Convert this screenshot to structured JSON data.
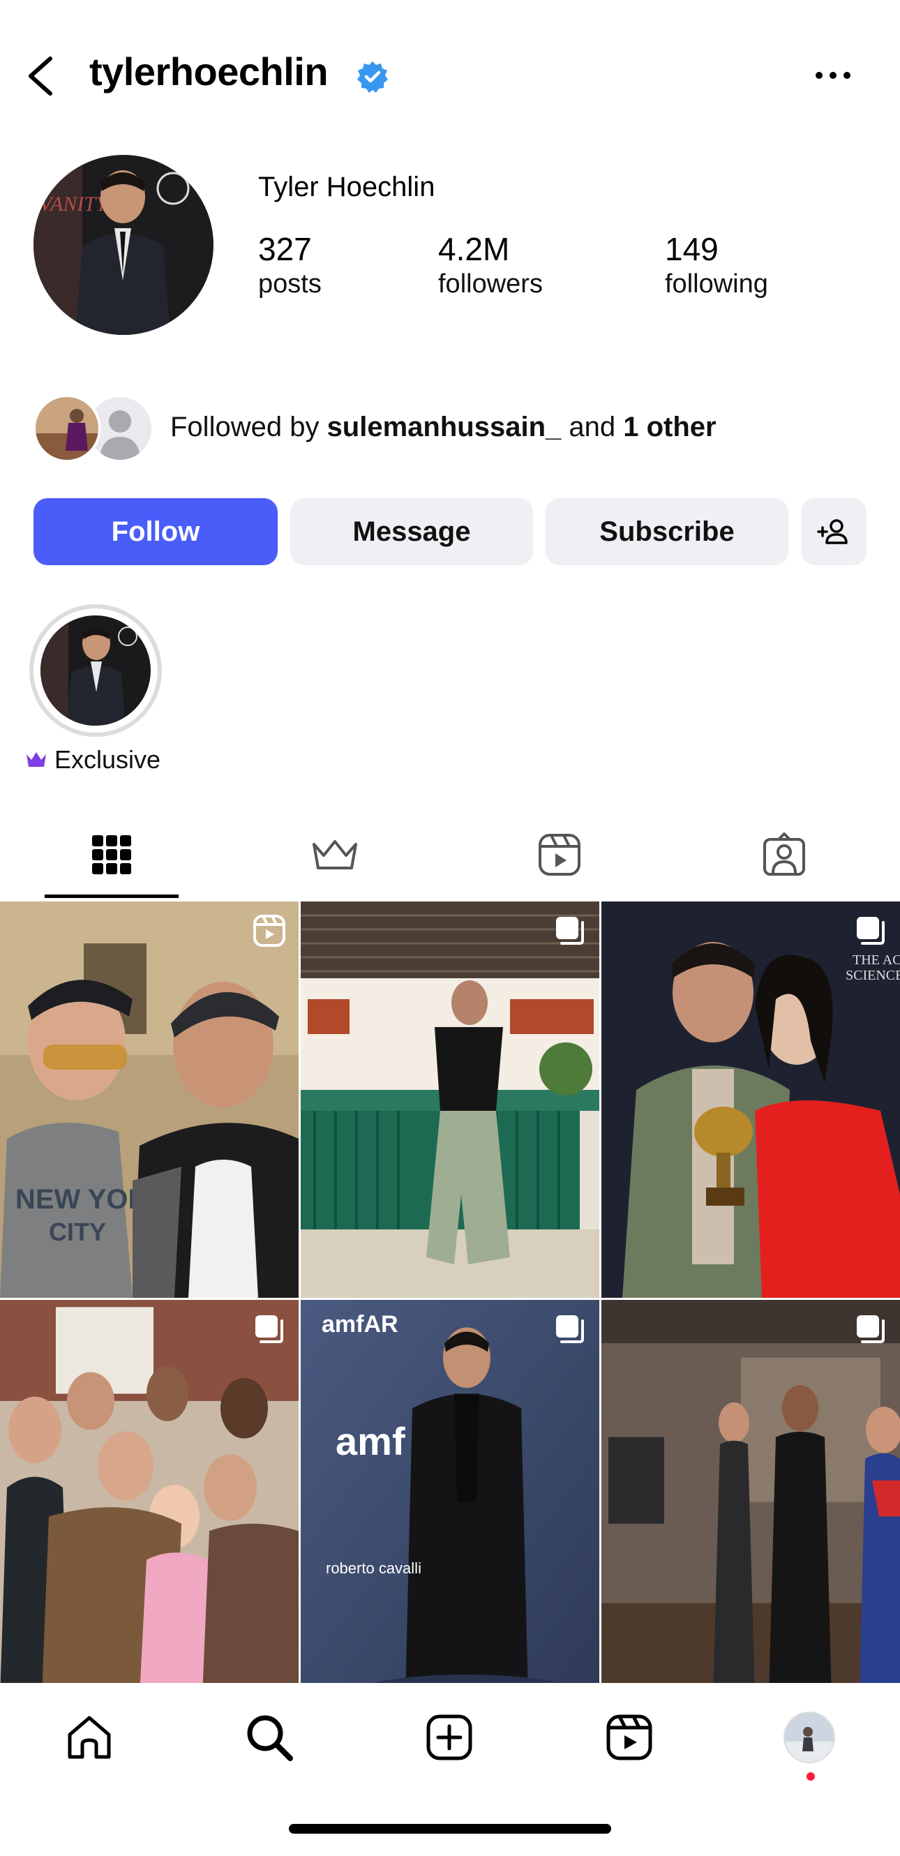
{
  "header": {
    "username": "tylerhoechlin",
    "verified": true,
    "back_icon": "chevron-left-icon",
    "more_icon": "ellipsis-icon"
  },
  "profile": {
    "display_name": "Tyler Hoechlin",
    "stats": [
      {
        "value": "327",
        "label": "posts"
      },
      {
        "value": "4.2M",
        "label": "followers"
      },
      {
        "value": "149",
        "label": "following"
      }
    ],
    "followed_by": {
      "prefix": "Followed by ",
      "name": "sulemanhussain_",
      "middle": " and ",
      "other": "1 other"
    }
  },
  "actions": {
    "follow": "Follow",
    "message": "Message",
    "subscribe": "Subscribe",
    "suggest_icon": "add-person-icon"
  },
  "highlight": {
    "label": "Exclusive",
    "icon": "crown-icon"
  },
  "tabs": [
    {
      "name": "posts-grid",
      "icon": "grid-icon",
      "active": true
    },
    {
      "name": "exclusive",
      "icon": "crown-icon",
      "active": false
    },
    {
      "name": "reels",
      "icon": "reels-icon",
      "active": false
    },
    {
      "name": "tagged",
      "icon": "tagged-person-icon",
      "active": false
    }
  ],
  "grid": [
    {
      "type": "reel",
      "icon": "reels-icon"
    },
    {
      "type": "carousel",
      "icon": "carousel-icon"
    },
    {
      "type": "carousel",
      "icon": "carousel-icon"
    },
    {
      "type": "carousel",
      "icon": "carousel-icon"
    },
    {
      "type": "carousel",
      "icon": "carousel-icon",
      "brand_text": "amfAR",
      "brand_text_2": "amf",
      "brand_text_3": "roberto cavalli"
    },
    {
      "type": "carousel",
      "icon": "carousel-icon"
    }
  ],
  "bottom_nav": [
    {
      "name": "home",
      "icon": "home-icon"
    },
    {
      "name": "search",
      "icon": "search-icon"
    },
    {
      "name": "create",
      "icon": "plus-square-icon"
    },
    {
      "name": "reels",
      "icon": "reels-icon"
    },
    {
      "name": "profile",
      "icon": "profile-avatar",
      "has_notification": true
    }
  ],
  "colors": {
    "follow_button": "#4a5df9",
    "secondary_button": "#efeff4",
    "verified": "#3897f0",
    "crown": "#7b3fe4",
    "notification_dot": "#ff1a3d"
  }
}
